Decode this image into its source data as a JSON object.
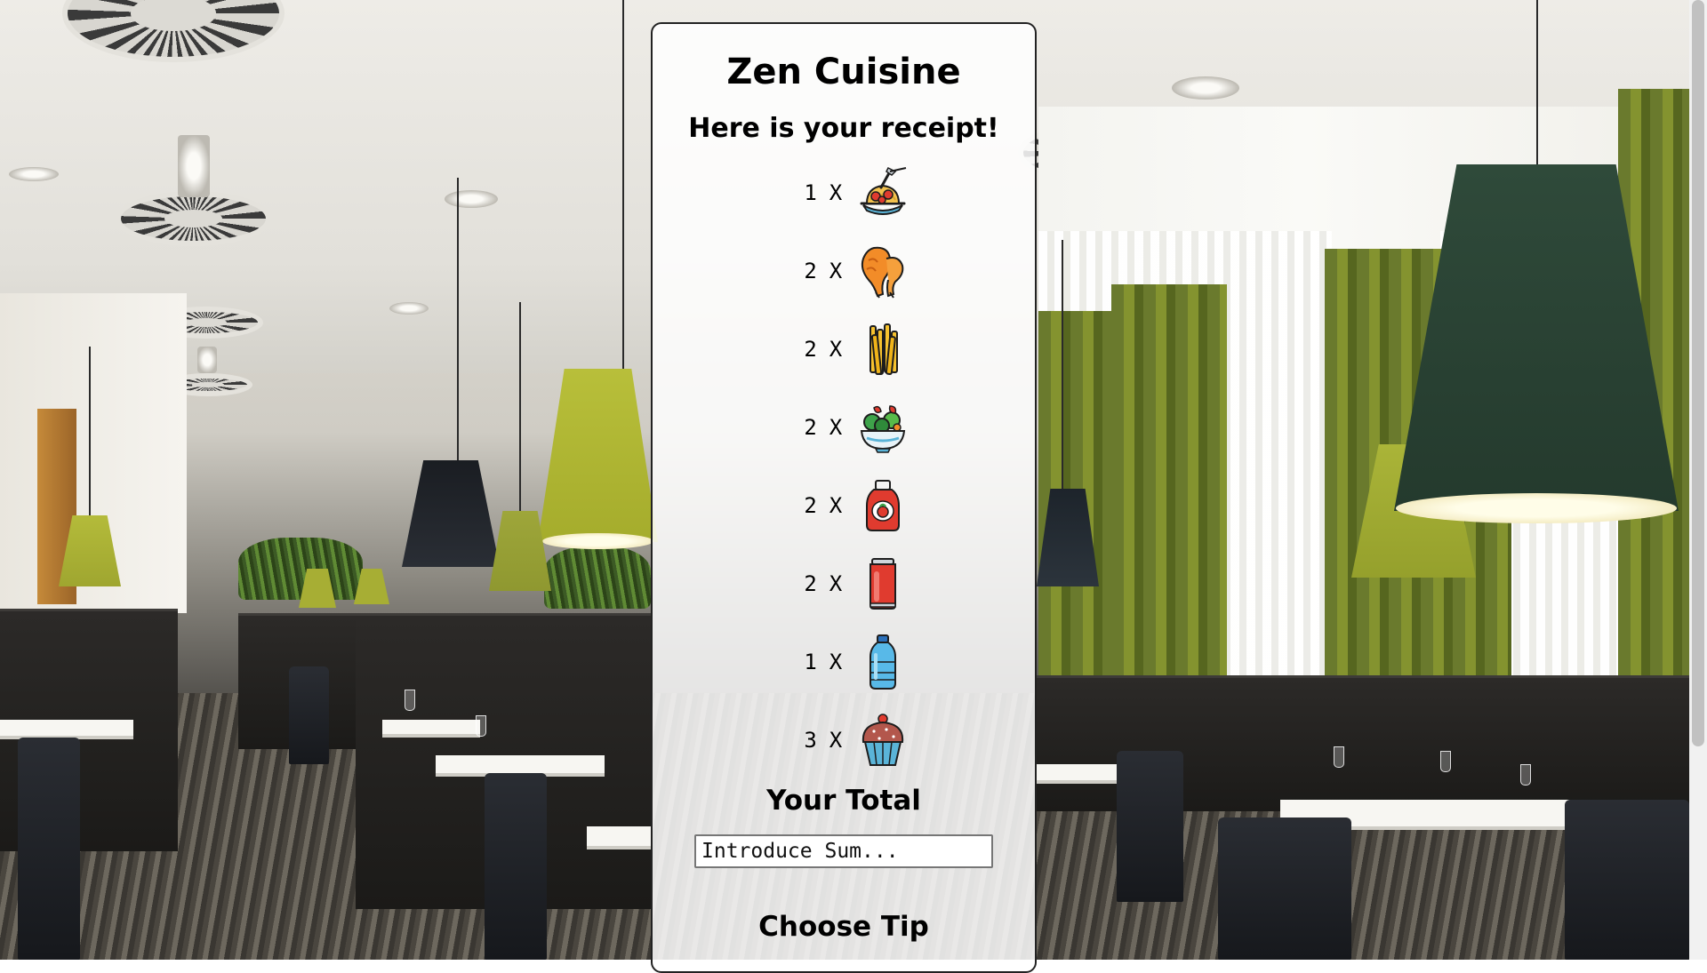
{
  "restaurant": {
    "name": "Zen Cuisine"
  },
  "receipt": {
    "heading": "Here is your receipt!",
    "items": [
      {
        "qty": "1",
        "times": "X",
        "icon": "spaghetti-icon"
      },
      {
        "qty": "2",
        "times": "X",
        "icon": "chicken-wing-icon"
      },
      {
        "qty": "2",
        "times": "X",
        "icon": "fries-icon"
      },
      {
        "qty": "2",
        "times": "X",
        "icon": "salad-icon"
      },
      {
        "qty": "2",
        "times": "X",
        "icon": "ketchup-bottle-icon"
      },
      {
        "qty": "2",
        "times": "X",
        "icon": "soda-can-icon"
      },
      {
        "qty": "1",
        "times": "X",
        "icon": "water-bottle-icon"
      },
      {
        "qty": "3",
        "times": "X",
        "icon": "cupcake-icon"
      }
    ],
    "total_label": "Your Total",
    "sum_placeholder": "Introduce Sum...",
    "tip_label": "Choose Tip"
  },
  "colors": {
    "panel_border": "#222222",
    "scene_curtain": "#84932f",
    "lamp_green_light": "#b8bf3a",
    "lamp_green_dark": "#2f4a3a"
  }
}
